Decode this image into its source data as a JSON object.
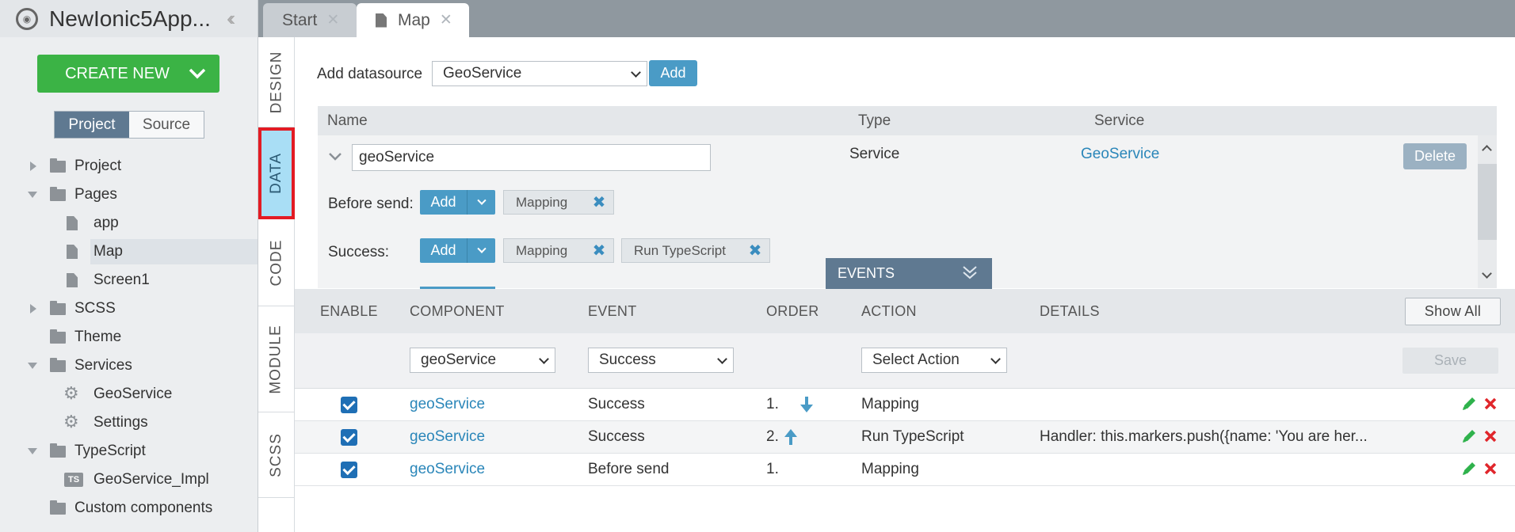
{
  "sidebar": {
    "app_title": "NewIonic5App...",
    "create_new_label": "CREATE NEW",
    "segments": {
      "project": "Project",
      "source": "Source"
    },
    "tree": [
      {
        "label": "Project",
        "type": "folder",
        "state": "collapsed"
      },
      {
        "label": "Pages",
        "type": "folder",
        "state": "expanded"
      },
      {
        "label": "app",
        "type": "page"
      },
      {
        "label": "Map",
        "type": "page",
        "selected": true
      },
      {
        "label": "Screen1",
        "type": "page"
      },
      {
        "label": "SCSS",
        "type": "folder",
        "state": "collapsed"
      },
      {
        "label": "Theme",
        "type": "folder"
      },
      {
        "label": "Services",
        "type": "folder",
        "state": "expanded"
      },
      {
        "label": "GeoService",
        "type": "service"
      },
      {
        "label": "Settings",
        "type": "service"
      },
      {
        "label": "TypeScript",
        "type": "folder",
        "state": "expanded"
      },
      {
        "label": "GeoService_Impl",
        "type": "ts",
        "badge": "TS"
      },
      {
        "label": "Custom components",
        "type": "folder"
      }
    ]
  },
  "tabs": [
    {
      "label": "Start",
      "active": false
    },
    {
      "label": "Map",
      "active": true
    }
  ],
  "vnav": [
    {
      "label": "DESIGN",
      "active": false
    },
    {
      "label": "DATA",
      "active": true
    },
    {
      "label": "CODE",
      "active": false
    },
    {
      "label": "MODULE",
      "active": false
    },
    {
      "label": "SCSS",
      "active": false
    }
  ],
  "datasource": {
    "add_label": "Add datasource",
    "selected": "GeoService",
    "add_button": "Add",
    "columns": {
      "name": "Name",
      "type": "Type",
      "service": "Service"
    },
    "row": {
      "name_value": "geoService",
      "type": "Service",
      "service": "GeoService",
      "delete_button": "Delete"
    },
    "before_send": {
      "label": "Before send:",
      "add": "Add",
      "chips": [
        "Mapping"
      ]
    },
    "success": {
      "label": "Success:",
      "add": "Add",
      "chips": [
        "Mapping",
        "Run TypeScript"
      ]
    }
  },
  "events": {
    "header": "EVENTS",
    "columns": {
      "enable": "ENABLE",
      "component": "COMPONENT",
      "event": "EVENT",
      "order": "ORDER",
      "action": "ACTION",
      "details": "DETAILS"
    },
    "show_all": "Show All",
    "filter": {
      "component": "geoService",
      "event": "Success",
      "action": "Select Action",
      "save": "Save"
    },
    "rows": [
      {
        "enabled": true,
        "component": "geoService",
        "event": "Success",
        "order": "1.",
        "order_arrow": "down",
        "action": "Mapping",
        "details": ""
      },
      {
        "enabled": true,
        "component": "geoService",
        "event": "Success",
        "order": "2.",
        "order_arrow": "up",
        "action": "Run TypeScript",
        "details": "Handler: this.markers.push({name: 'You are her..."
      },
      {
        "enabled": true,
        "component": "geoService",
        "event": "Before send",
        "order": "1.",
        "order_arrow": "",
        "action": "Mapping",
        "details": ""
      }
    ]
  },
  "colors": {
    "create_green": "#3bb345",
    "accent_blue": "#4a9bc6",
    "link_blue": "#2a86b9",
    "data_tab_highlight": "#a9def5",
    "annotation_red": "#e31b23"
  }
}
